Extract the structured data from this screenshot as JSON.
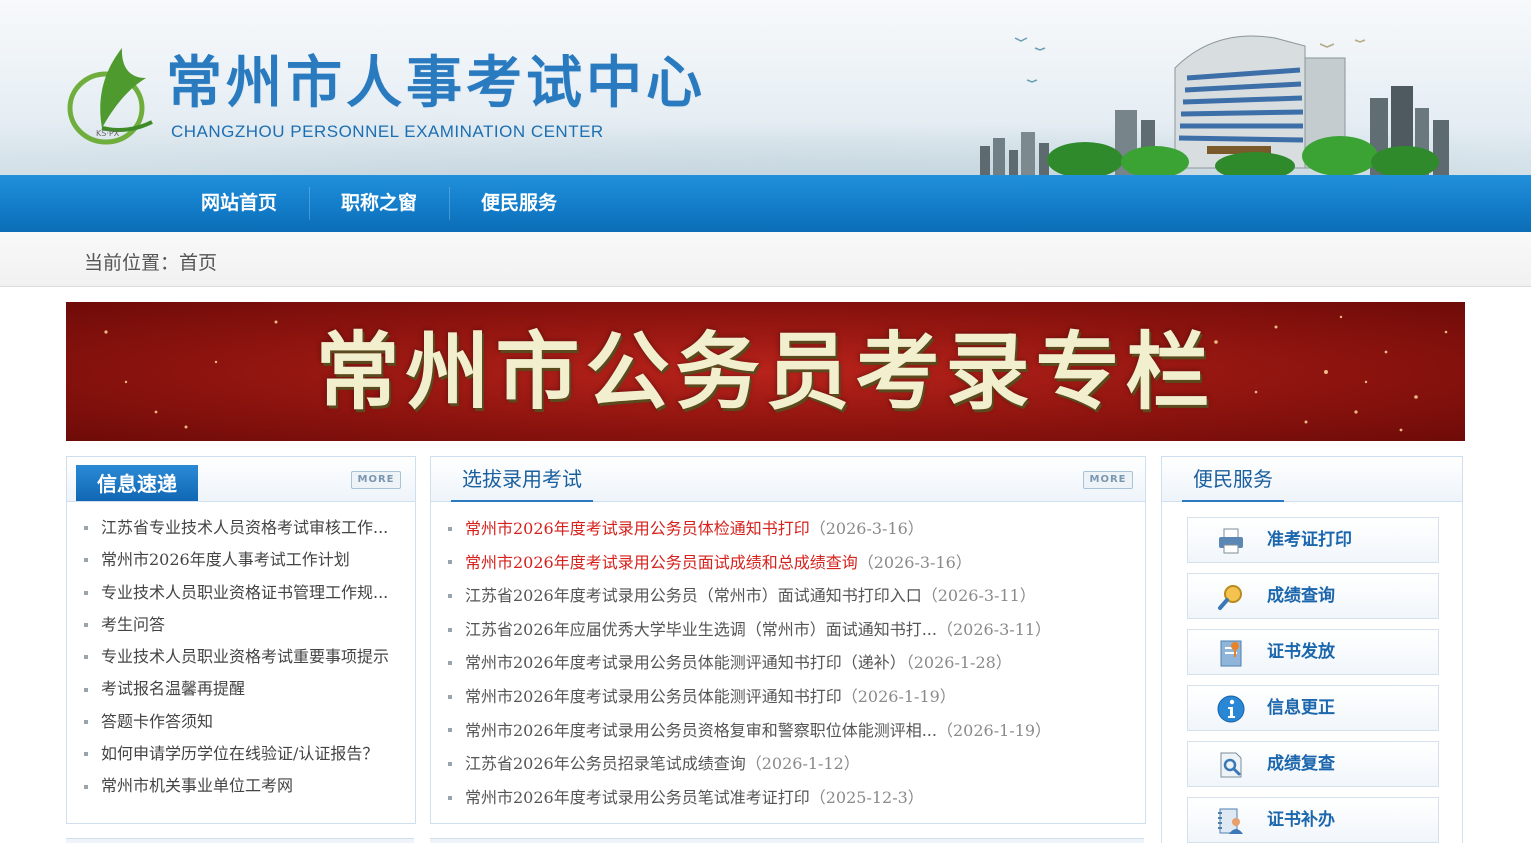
{
  "header": {
    "title": "常州市人事考试中心",
    "subtitle": "CHANGZHOU PERSONNEL EXAMINATION CENTER",
    "logo_mark_text": "KS·PX"
  },
  "nav": {
    "items": [
      {
        "label": "网站首页"
      },
      {
        "label": "职称之窗"
      },
      {
        "label": "便民服务"
      }
    ]
  },
  "breadcrumb": {
    "text": "当前位置：首页"
  },
  "banner": {
    "text": "常州市公务员考录专栏"
  },
  "info_panel": {
    "title": "信息速递",
    "more": "MORE",
    "items": [
      "江苏省专业技术人员资格考试审核工作...",
      "常州市2026年度人事考试工作计划",
      "专业技术人员职业资格证书管理工作规...",
      "考生问答",
      "专业技术人员职业资格考试重要事项提示",
      "考试报名温馨再提醒",
      "答题卡作答须知",
      "如何申请学历学位在线验证/认证报告？",
      "常州市机关事业单位工考网"
    ]
  },
  "exam_panel": {
    "title": "选拔录用考试",
    "more": "MORE",
    "items": [
      {
        "title": "常州市2026年度考试录用公务员体检通知书打印",
        "date": "（2026-3-16）",
        "hot": true
      },
      {
        "title": "常州市2026年度考试录用公务员面试成绩和总成绩查询",
        "date": "（2026-3-16）",
        "hot": true
      },
      {
        "title": "江苏省2026年度考试录用公务员（常州市）面试通知书打印入口",
        "date": "（2026-3-11）",
        "hot": false
      },
      {
        "title": "江苏省2026年应届优秀大学毕业生选调（常州市）面试通知书打...",
        "date": "（2026-3-11）",
        "hot": false
      },
      {
        "title": "常州市2026年度考试录用公务员体能测评通知书打印（递补）",
        "date": "（2026-1-28）",
        "hot": false
      },
      {
        "title": "常州市2026年度考试录用公务员体能测评通知书打印",
        "date": "（2026-1-19）",
        "hot": false
      },
      {
        "title": "常州市2026年度考试录用公务员资格复审和警察职位体能测评相...",
        "date": "（2026-1-19）",
        "hot": false
      },
      {
        "title": "江苏省2026年公务员招录笔试成绩查询",
        "date": "（2026-1-12）",
        "hot": false
      },
      {
        "title": "常州市2026年度考试录用公务员笔试准考证打印",
        "date": "（2025-12-3）",
        "hot": false
      }
    ]
  },
  "service_panel": {
    "title": "便民服务",
    "items": [
      {
        "label": "准考证打印",
        "icon": "printer-icon"
      },
      {
        "label": "成绩查询",
        "icon": "magnifier-icon"
      },
      {
        "label": "证书发放",
        "icon": "certificate-icon"
      },
      {
        "label": "信息更正",
        "icon": "info-icon"
      },
      {
        "label": "成绩复查",
        "icon": "document-search-icon"
      },
      {
        "label": "证书补办",
        "icon": "user-card-icon"
      }
    ]
  },
  "colors": {
    "nav_blue": "#137dca",
    "link_blue": "#1b66ad",
    "hot_red": "#d5221d",
    "banner_red": "#8f140f"
  }
}
